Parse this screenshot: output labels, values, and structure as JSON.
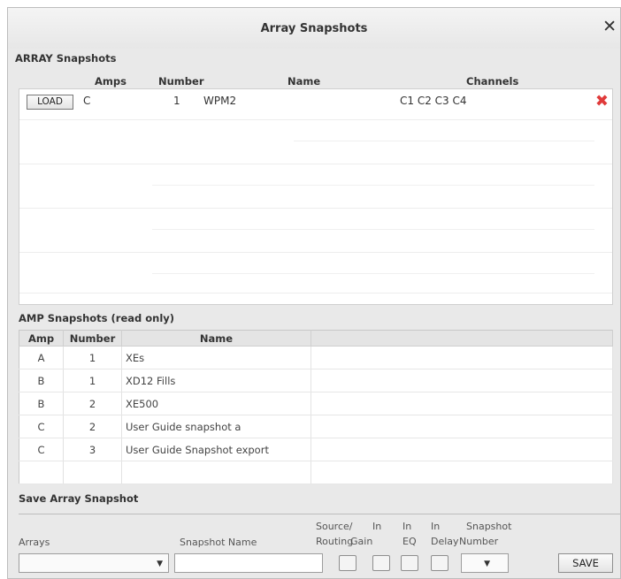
{
  "window": {
    "title": "Array Snapshots",
    "close_glyph": "✕"
  },
  "array_section": {
    "title": "ARRAY Snapshots",
    "columns": {
      "amps": "Amps",
      "number": "Number",
      "name": "Name",
      "channels": "Channels"
    },
    "rows": [
      {
        "load": "LOAD",
        "amps": "C",
        "number": "1",
        "name": "WPM2",
        "channels": "C1 C2 C3 C4",
        "delete_icon": "delete-x-icon"
      }
    ]
  },
  "amp_section": {
    "title": "AMP Snapshots (read only)",
    "columns": {
      "amp": "Amp",
      "number": "Number",
      "name": "Name"
    },
    "rows": [
      {
        "amp": "A",
        "number": "1",
        "name": "XEs"
      },
      {
        "amp": "B",
        "number": "1",
        "name": "XD12 Fills"
      },
      {
        "amp": "B",
        "number": "2",
        "name": "XE500"
      },
      {
        "amp": "C",
        "number": "2",
        "name": "User Guide snapshot a"
      },
      {
        "amp": "C",
        "number": "3",
        "name": "User Guide Snapshot export"
      }
    ]
  },
  "save_section": {
    "title": "Save Array Snapshot",
    "labels": {
      "arrays": "Arrays",
      "snapshot_name": "Snapshot Name",
      "source_routing_top": "Source/",
      "source_routing_bottom": "Routing",
      "in_gain_top": "In",
      "in_gain_bottom": "Gain",
      "in_eq_top": "In",
      "in_eq_bottom": "EQ",
      "in_delay_top": "In",
      "in_delay_bottom": "Delay",
      "snapshot_number_top": "Snapshot",
      "snapshot_number_bottom": "Number"
    },
    "arrays_value": "",
    "snapshot_name_value": "",
    "snapshot_number_value": "",
    "save_label": "SAVE"
  },
  "colors": {
    "delete": "#e03a3a",
    "window_bg": "#e9e9e9"
  }
}
